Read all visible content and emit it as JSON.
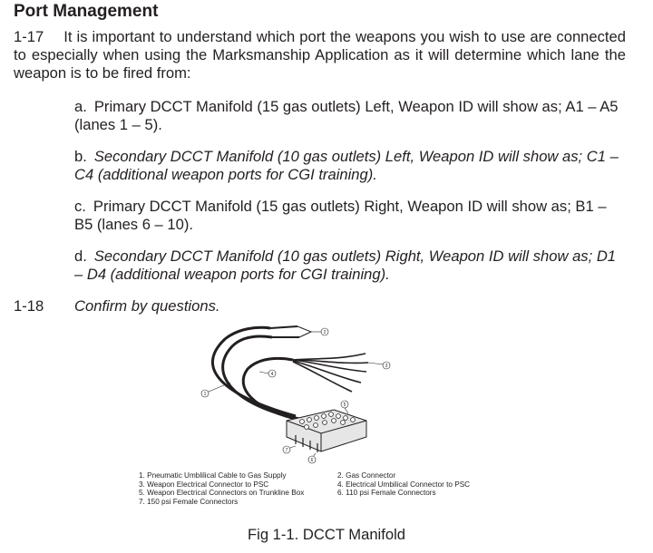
{
  "heading": "Port Management",
  "para": {
    "num": "1-17",
    "text": "It is important to understand which port the weapons you wish to use are connected to especially when using the Marksmanship Application as it will determine which lane the weapon is to be fired from:"
  },
  "items": [
    {
      "letter": "a.",
      "text": "Primary DCCT Manifold (15 gas outlets) Left, Weapon ID will show as; A1 – A5 (lanes 1 – 5)."
    },
    {
      "letter": "b.",
      "text": "Secondary DCCT Manifold (10 gas outlets) Left,  Weapon ID will show as; C1 – C4 (additional weapon ports for CGI training)."
    },
    {
      "letter": "c.",
      "text": "Primary DCCT Manifold (15 gas outlets) Right, Weapon ID will show as; B1 – B5 (lanes 6 – 10)."
    },
    {
      "letter": "d.",
      "text": "Secondary DCCT Manifold (10 gas outlets) Right, Weapon ID will show as; D1 – D4 (additional weapon ports for CGI training)."
    }
  ],
  "confirm": {
    "num": "1-18",
    "text": "Confirm by questions."
  },
  "figure": {
    "callouts": [
      "1",
      "2",
      "3",
      "4",
      "5",
      "6",
      "7"
    ]
  },
  "legend": {
    "left": [
      "1.  Pneumatic Umblilical Cable to Gas Supply",
      "3.  Weapon Electrical Connector to PSC",
      "5.  Weapon Electrical Connectors on Trunkline Box",
      "7.  150 psi Female Connectors"
    ],
    "right": [
      "2.  Gas Connector",
      "4.  Electrical Umbilical Connector to PSC",
      "6.  110 psi Female Connectors"
    ]
  },
  "caption": "Fig 1-1. DCCT Manifold"
}
